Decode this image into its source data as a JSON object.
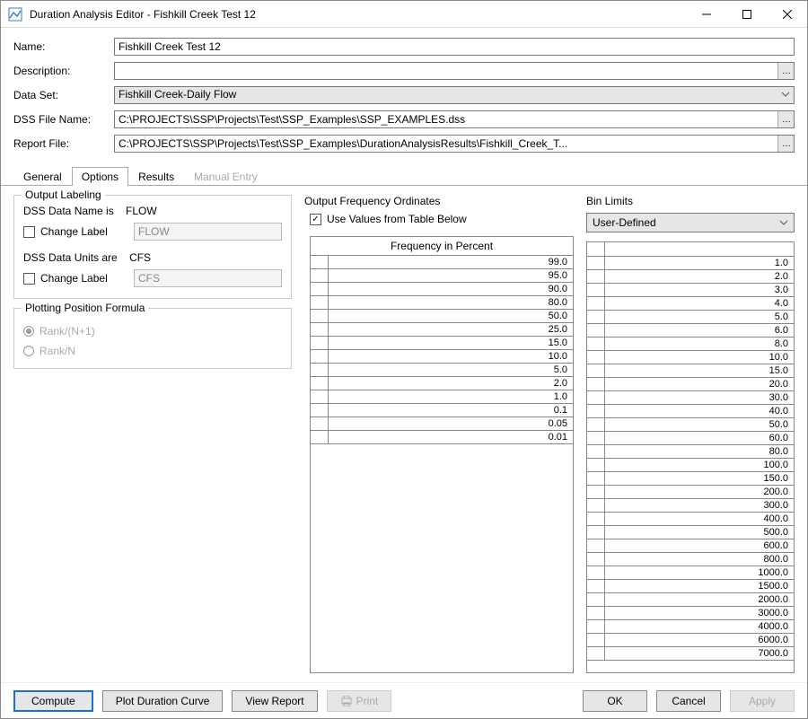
{
  "window": {
    "title": "Duration Analysis Editor - Fishkill Creek Test 12"
  },
  "form": {
    "name_label": "Name:",
    "name_value": "Fishkill Creek Test 12",
    "desc_label": "Description:",
    "desc_value": "",
    "dataset_label": "Data Set:",
    "dataset_value": "Fishkill Creek-Daily Flow",
    "dssfile_label": "DSS File Name:",
    "dssfile_value": "C:\\PROJECTS\\SSP\\Projects\\Test\\SSP_Examples\\SSP_EXAMPLES.dss",
    "report_label": "Report File:",
    "report_value": "C:\\PROJECTS\\SSP\\Projects\\Test\\SSP_Examples\\DurationAnalysisResults\\Fishkill_Creek_T..."
  },
  "tabs": {
    "general": "General",
    "options": "Options",
    "results": "Results",
    "manual": "Manual Entry"
  },
  "output_labeling": {
    "group_title": "Output Labeling",
    "name_line": "DSS Data Name is",
    "name_val": "FLOW",
    "change_label": "Change Label",
    "name_input": "FLOW",
    "units_line": "DSS Data Units are",
    "units_val": "CFS",
    "units_input": "CFS"
  },
  "plotting": {
    "group_title": "Plotting Position Formula",
    "opt1": "Rank/(N+1)",
    "opt2": "Rank/N"
  },
  "freq": {
    "title": "Output Frequency Ordinates",
    "use_table": "Use Values from Table Below",
    "header": "Frequency in Percent",
    "values": [
      "99.0",
      "95.0",
      "90.0",
      "80.0",
      "50.0",
      "25.0",
      "15.0",
      "10.0",
      "5.0",
      "2.0",
      "1.0",
      "0.1",
      "0.05",
      "0.01"
    ]
  },
  "bins": {
    "title": "Bin Limits",
    "mode": "User-Defined",
    "values": [
      "1.0",
      "2.0",
      "3.0",
      "4.0",
      "5.0",
      "6.0",
      "8.0",
      "10.0",
      "15.0",
      "20.0",
      "30.0",
      "40.0",
      "50.0",
      "60.0",
      "80.0",
      "100.0",
      "150.0",
      "200.0",
      "300.0",
      "400.0",
      "500.0",
      "600.0",
      "800.0",
      "1000.0",
      "1500.0",
      "2000.0",
      "3000.0",
      "4000.0",
      "6000.0",
      "7000.0"
    ]
  },
  "footer": {
    "compute": "Compute",
    "plot": "Plot Duration Curve",
    "view": "View Report",
    "print": "Print",
    "ok": "OK",
    "cancel": "Cancel",
    "apply": "Apply"
  }
}
